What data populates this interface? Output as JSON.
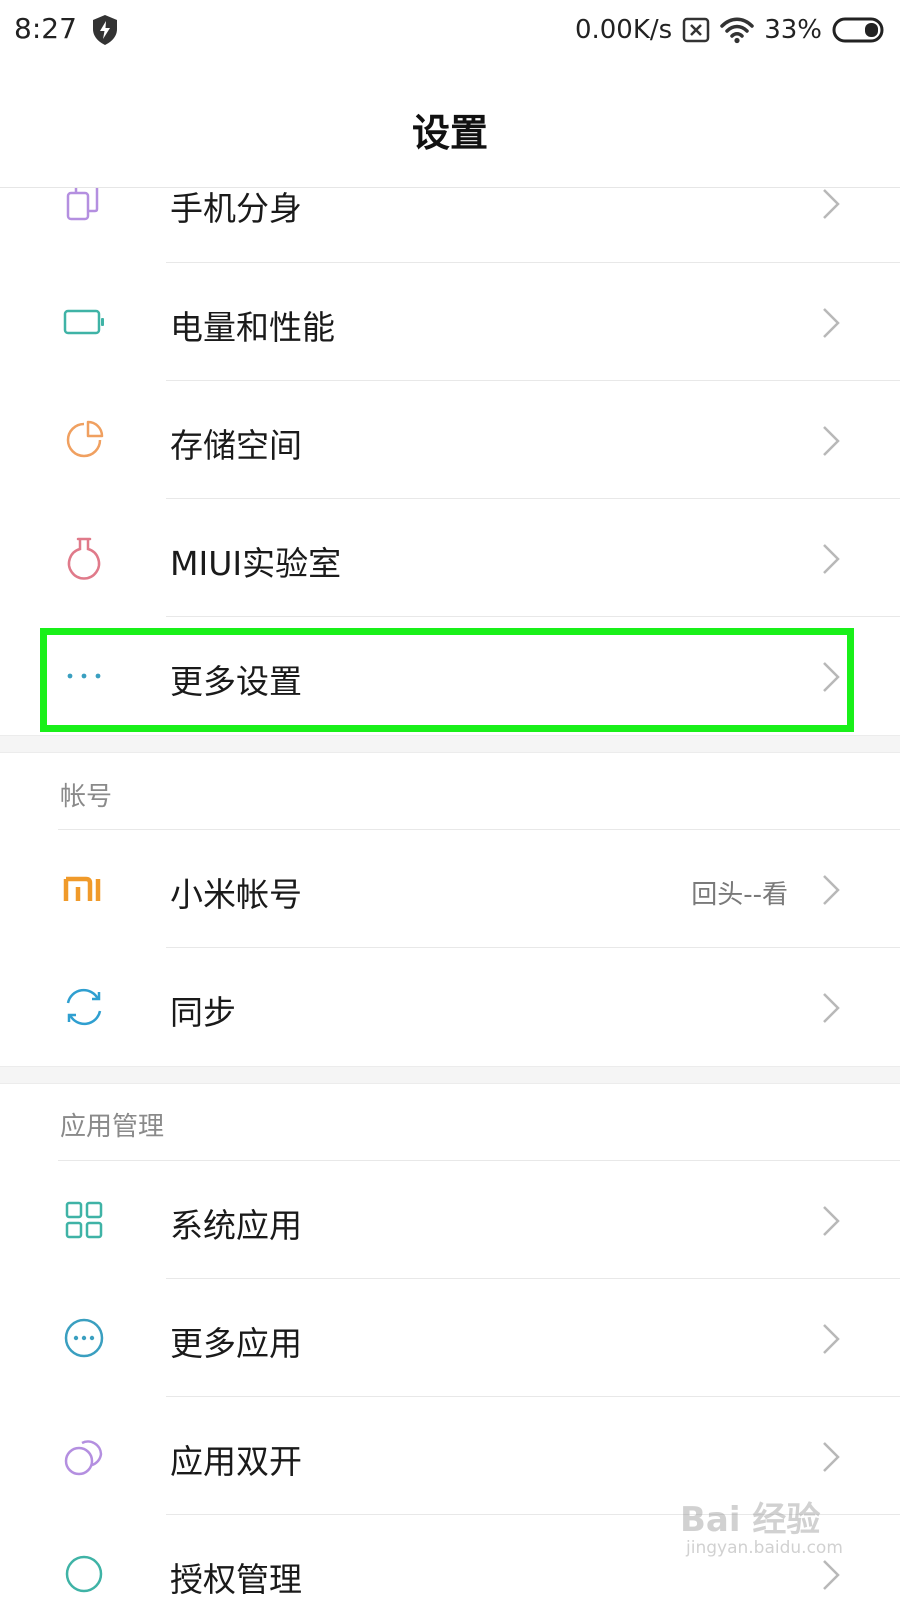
{
  "status_bar": {
    "time": "8:27",
    "network_speed": "0.00K/s",
    "battery_percent": "33%",
    "battery_level": 0.33
  },
  "header": {
    "title": "设置"
  },
  "rows_top": [
    {
      "label": "手机分身",
      "icon": "dual-phone-icon",
      "color": "#b48fe0"
    },
    {
      "label": "电量和性能",
      "icon": "battery-icon",
      "color": "#3fb3a6"
    },
    {
      "label": "存储空间",
      "icon": "pie-chart-icon",
      "color": "#f0a060"
    },
    {
      "label": "MIUI实验室",
      "icon": "flask-icon",
      "color": "#e07a8a"
    },
    {
      "label": "更多设置",
      "icon": "more-dots-icon",
      "color": "#3a9fc0"
    }
  ],
  "account_section": {
    "header": "帐号",
    "rows": [
      {
        "label": "小米帐号",
        "value": "回头--看",
        "icon": "mi-logo-icon",
        "color": "#f09a2a"
      },
      {
        "label": "同步",
        "icon": "sync-icon",
        "color": "#2f9fd0"
      }
    ]
  },
  "apps_section": {
    "header": "应用管理",
    "rows": [
      {
        "label": "系统应用",
        "icon": "grid-apps-icon",
        "color": "#3fb3a6"
      },
      {
        "label": "更多应用",
        "icon": "more-circle-icon",
        "color": "#3a9fc0"
      },
      {
        "label": "应用双开",
        "icon": "dual-circles-icon",
        "color": "#b48fe0"
      },
      {
        "label": "授权管理",
        "icon": "permission-icon",
        "color": "#3fb3a6"
      }
    ]
  },
  "highlight_color": "#19f019",
  "watermark": {
    "brand": "Bai 经验",
    "url": "jingyan.baidu.com"
  }
}
